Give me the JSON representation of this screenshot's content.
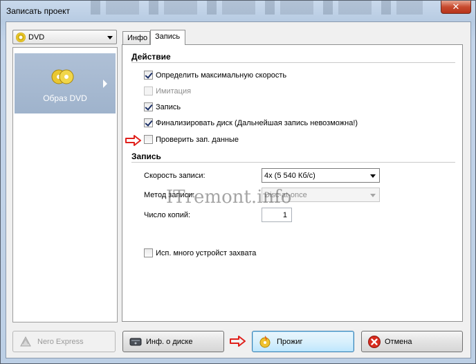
{
  "window": {
    "title": "Записать проект",
    "close_glyph": "✕"
  },
  "left": {
    "type_select": {
      "value": "DVD",
      "icon": "dvd-disc-icon"
    },
    "items": [
      {
        "label": "Образ DVD",
        "icon": "dvd-image-icon"
      }
    ]
  },
  "tabs": [
    {
      "label": "Инфо"
    },
    {
      "label": "Запись"
    }
  ],
  "action": {
    "title": "Действие",
    "checkboxes": [
      {
        "label": "Определить максимальную скорость",
        "checked": true,
        "enabled": true
      },
      {
        "label": "Имитация",
        "checked": false,
        "enabled": false
      },
      {
        "label": "Запись",
        "checked": true,
        "enabled": true
      },
      {
        "label": "Финализировать диск (Дальнейшая запись невозможна!)",
        "checked": true,
        "enabled": true
      },
      {
        "label": "Проверить зап. данные",
        "checked": false,
        "enabled": true
      }
    ]
  },
  "record": {
    "title": "Запись",
    "speed_label": "Скорость записи:",
    "speed_value": "4x (5 540 Кб/с)",
    "method_label": "Метод записи:",
    "method_value": "Disc-at-once",
    "copies_label": "Число копий:",
    "copies_value": "1",
    "multi_device_label": "Исп. много устройст захвата",
    "multi_device_checked": false
  },
  "watermark": "ITremont.info",
  "buttons": {
    "nero_express": "Nero Express",
    "disc_info": "Инф. о диске",
    "burn": "Прожиг",
    "cancel": "Отмена"
  },
  "colors": {
    "annotation_arrow": "#e0201b",
    "selection": "#a8bbd3"
  }
}
